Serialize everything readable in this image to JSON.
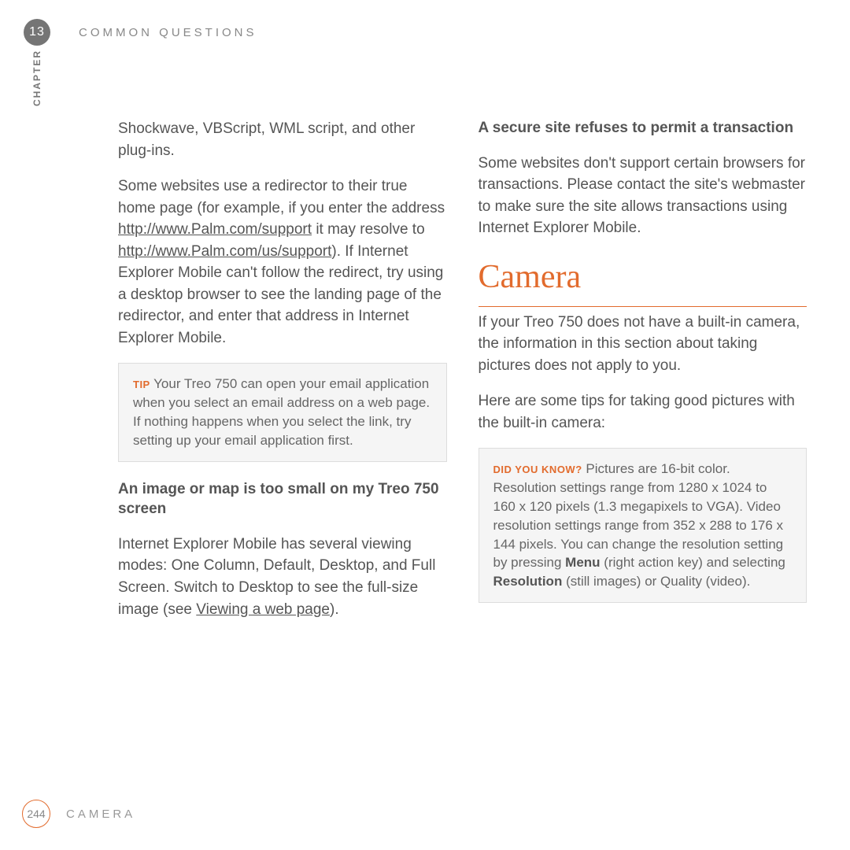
{
  "header": {
    "chapter_number": "13",
    "chapter_title": "COMMON QUESTIONS",
    "side_label": "CHAPTER"
  },
  "left": {
    "para1": "Shockwave, VBScript, WML script, and other plug-ins.",
    "para2a": "Some websites use a redirector to their true home page (for example, if you enter the address ",
    "link1": "http://www.Palm.com/support",
    "para2b": " it may resolve to ",
    "link2": "http://www.Palm.com/us/support",
    "para2c": "). If Internet Explorer Mobile can't follow the redirect, try using a desktop browser to see the landing page of the redirector, and enter that address in Internet Explorer Mobile.",
    "tip_label": "TIP",
    "tip_text": " Your Treo 750 can open your email application when you select an email address on a web page. If nothing happens when you select the link, try setting up your email application first.",
    "sub1": "An image or map is too small on my Treo 750 screen",
    "para3a": "Internet Explorer Mobile has several viewing modes: One Column, Default, Desktop, and Full Screen. Switch to Desktop to see the full-size image (see ",
    "link3": "Viewing a web page",
    "para3b": ")."
  },
  "right": {
    "sub1": "A secure site refuses to permit a transaction",
    "para1": "Some websites don't support certain browsers for transactions. Please contact the site's webmaster to make sure the site allows transactions using Internet Explorer Mobile.",
    "section": "Camera",
    "para2": "If your Treo 750 does not have a built-in camera, the information in this section about taking pictures does not apply to you.",
    "para3": "Here are some tips for taking good pictures with the built-in camera:",
    "dyk_label": "DID YOU KNOW?",
    "dyk_a": " Pictures are 16-bit color. Resolution settings range from 1280 x 1024 to 160 x 120 pixels (1.3 megapixels to VGA). Video resolution settings range from 352 x 288 to 176 x 144 pixels. You can change the resolution setting by pressing ",
    "dyk_menu": "Menu",
    "dyk_b": " (right action key) and selecting ",
    "dyk_res": "Resolution",
    "dyk_c": " (still images) or Quality (video)."
  },
  "footer": {
    "page_number": "244",
    "section": "CAMERA"
  }
}
